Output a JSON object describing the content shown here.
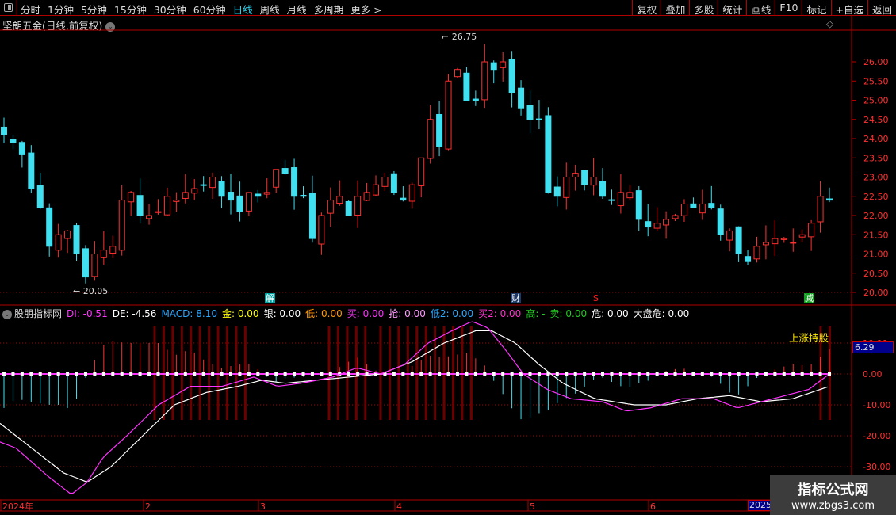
{
  "toolbar": {
    "periods": [
      "分时",
      "1分钟",
      "5分钟",
      "15分钟",
      "30分钟",
      "60分钟",
      "日线",
      "周线",
      "月线",
      "多周期",
      "更多 >"
    ],
    "active": "日线",
    "tools": [
      "复权",
      "叠加",
      "多股",
      "统计",
      "画线",
      "F10",
      "标记",
      "+自选",
      "返回"
    ]
  },
  "title": "坚朗五金(日线,前复权)",
  "annotations": {
    "high": "26.75",
    "low": "20.05",
    "signal": "上涨持股"
  },
  "markers": [
    {
      "label": "解",
      "color": "#00a0a0"
    },
    {
      "label": "财",
      "color": "#1a3a6a"
    },
    {
      "label": "S",
      "color": "#ff2020"
    },
    {
      "label": "减",
      "color": "#10a020"
    }
  ],
  "indicator": {
    "name": "股朋指标网",
    "items": [
      {
        "label": "DI: -0.51",
        "color": "#ff33ff"
      },
      {
        "label": "DE: -4.56",
        "color": "#ffffff"
      },
      {
        "label": "MACD: 8.10",
        "color": "#2aa8ff"
      },
      {
        "label": "金: 0.00",
        "color": "#ffff00"
      },
      {
        "label": "银: 0.00",
        "color": "#ffffff"
      },
      {
        "label": "低: 0.00",
        "color": "#ff9900"
      },
      {
        "label": "买: 0.00",
        "color": "#ff33ff"
      },
      {
        "label": "抢: 0.00",
        "color": "#ff99ff"
      },
      {
        "label": "低2: 0.00",
        "color": "#2aa8ff"
      },
      {
        "label": "买2: 0.00",
        "color": "#ff33cc"
      },
      {
        "label": "高: -",
        "color": "#22cc22"
      },
      {
        "label": "卖: 0.00",
        "color": "#22cc22"
      },
      {
        "label": "危: 0.00",
        "color": "#ffffff"
      },
      {
        "label": "大盘危: 0.00",
        "color": "#ffffff"
      }
    ],
    "current_value": "6.29"
  },
  "price_axis": [
    "26.00",
    "25.50",
    "25.00",
    "24.50",
    "24.00",
    "23.50",
    "23.00",
    "22.50",
    "22.00",
    "21.50",
    "21.00",
    "20.50",
    "20.00"
  ],
  "indicator_axis": [
    "10.00",
    "0.00",
    "-10.00",
    "-20.00",
    "-30.00"
  ],
  "date_axis": [
    "2024年",
    "2",
    "3",
    "4",
    "5",
    "6"
  ],
  "date_2025": "2025",
  "watermark": {
    "name": "指标公式网",
    "url": "www.zbgs3.com"
  },
  "colors": {
    "up": "#ff3030",
    "down": "#40e0f0",
    "grid": "#b00000"
  },
  "chart_data": {
    "type": "candlestick",
    "close": [
      24.1,
      23.9,
      23.6,
      22.7,
      22.2,
      21.2,
      21.5,
      21.6,
      21.0,
      20.4,
      21.0,
      21.1,
      21.2,
      22.4,
      22.6,
      22.0,
      22.0,
      22.1,
      22.5,
      22.4,
      22.6,
      22.7,
      22.8,
      23.0,
      22.5,
      22.4,
      22.1,
      22.6,
      22.5,
      22.6,
      23.2,
      23.1,
      22.5,
      22.5,
      21.4,
      22.0,
      22.4,
      22.5,
      22.0,
      22.5,
      22.6,
      22.8,
      23.0,
      22.6,
      22.4,
      22.8,
      23.5,
      24.5,
      23.8,
      25.5,
      25.8,
      25.0,
      25.0,
      26.0,
      25.8,
      26.0,
      25.2,
      24.8,
      24.5,
      24.5,
      22.6,
      22.5,
      23.0,
      23.1,
      22.8,
      23.0,
      22.5,
      22.4,
      22.6,
      22.6,
      21.9,
      21.7,
      21.8,
      21.9,
      22.0,
      22.3,
      22.2,
      22.3,
      22.2,
      21.5,
      21.6,
      21.0,
      20.8,
      21.2,
      21.3,
      21.4,
      21.4,
      21.3,
      21.5,
      21.8,
      22.5,
      22.4
    ],
    "high_label": 26.75,
    "low_label": 20.05,
    "dif": [
      [
        0,
        -22
      ],
      [
        20,
        -24
      ],
      [
        60,
        -33
      ],
      [
        90,
        -39
      ],
      [
        110,
        -35
      ],
      [
        130,
        -27
      ],
      [
        160,
        -20
      ],
      [
        200,
        -10
      ],
      [
        240,
        -4
      ],
      [
        280,
        -4
      ],
      [
        320,
        -1
      ],
      [
        350,
        -4
      ],
      [
        380,
        -3
      ],
      [
        420,
        -1
      ],
      [
        450,
        2
      ],
      [
        480,
        0
      ],
      [
        510,
        3
      ],
      [
        540,
        10
      ],
      [
        570,
        14
      ],
      [
        595,
        17
      ],
      [
        615,
        15
      ],
      [
        640,
        7
      ],
      [
        660,
        0
      ],
      [
        690,
        -5
      ],
      [
        720,
        -8
      ],
      [
        760,
        -9
      ],
      [
        790,
        -12
      ],
      [
        820,
        -11
      ],
      [
        860,
        -8
      ],
      [
        900,
        -8
      ],
      [
        930,
        -11
      ],
      [
        960,
        -9
      ],
      [
        990,
        -7
      ],
      [
        1020,
        -5
      ],
      [
        1046,
        0
      ]
    ],
    "dea": [
      [
        0,
        -16
      ],
      [
        40,
        -24
      ],
      [
        80,
        -32
      ],
      [
        110,
        -35
      ],
      [
        140,
        -30
      ],
      [
        180,
        -20
      ],
      [
        220,
        -10
      ],
      [
        260,
        -6
      ],
      [
        300,
        -4
      ],
      [
        330,
        -2
      ],
      [
        360,
        -3
      ],
      [
        400,
        -2
      ],
      [
        440,
        -1
      ],
      [
        480,
        0
      ],
      [
        520,
        4
      ],
      [
        560,
        10
      ],
      [
        600,
        14
      ],
      [
        620,
        14
      ],
      [
        650,
        10
      ],
      [
        680,
        3
      ],
      [
        710,
        -3
      ],
      [
        750,
        -8
      ],
      [
        800,
        -10
      ],
      [
        840,
        -10
      ],
      [
        880,
        -8
      ],
      [
        920,
        -7
      ],
      [
        960,
        -9
      ],
      [
        1000,
        -8
      ],
      [
        1046,
        -4
      ]
    ]
  }
}
